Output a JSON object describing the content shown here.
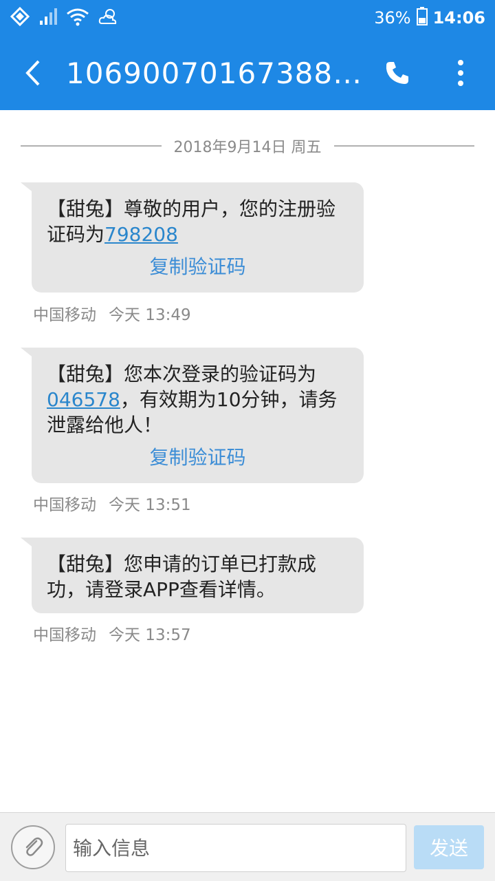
{
  "status_bar": {
    "battery": "36%",
    "time": "14:06"
  },
  "app_bar": {
    "title": "10690070167388…"
  },
  "date_divider": "2018年9月14日 周五",
  "messages": [
    {
      "text_before": "【甜兔】尊敬的用户，您的注册验证码为",
      "code": "798208",
      "text_after": "",
      "copy_label": "复制验证码",
      "carrier": "中国移动",
      "time": "今天 13:49"
    },
    {
      "text_before": "【甜兔】您本次登录的验证码为",
      "code": "046578",
      "text_after": "，有效期为10分钟，请务泄露给他人！",
      "copy_label": "复制验证码",
      "carrier": "中国移动",
      "time": "今天 13:51"
    },
    {
      "text_before": "【甜兔】您申请的订单已打款成功，请登录APP查看详情。",
      "code": "",
      "text_after": "",
      "copy_label": "",
      "carrier": "中国移动",
      "time": "今天 13:57"
    }
  ],
  "input_bar": {
    "placeholder": "输入信息",
    "send_label": "发送"
  }
}
